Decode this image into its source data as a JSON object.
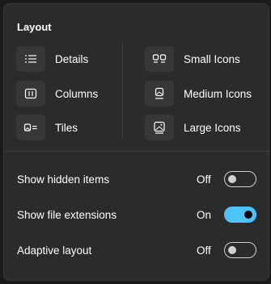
{
  "layout": {
    "title": "Layout",
    "left_items": [
      {
        "label": "Details",
        "icon": "details-icon"
      },
      {
        "label": "Columns",
        "icon": "columns-icon"
      },
      {
        "label": "Tiles",
        "icon": "tiles-icon"
      }
    ],
    "right_items": [
      {
        "label": "Small Icons",
        "icon": "small-icons-icon"
      },
      {
        "label": "Medium Icons",
        "icon": "medium-icons-icon"
      },
      {
        "label": "Large Icons",
        "icon": "large-icons-icon"
      }
    ]
  },
  "toggles": [
    {
      "label": "Show hidden items",
      "state": "Off",
      "on": false
    },
    {
      "label": "Show file extensions",
      "state": "On",
      "on": true
    },
    {
      "label": "Adaptive layout",
      "state": "Off",
      "on": false
    }
  ],
  "colors": {
    "accent": "#4cc2ff",
    "panel": "#2b2b2b"
  }
}
